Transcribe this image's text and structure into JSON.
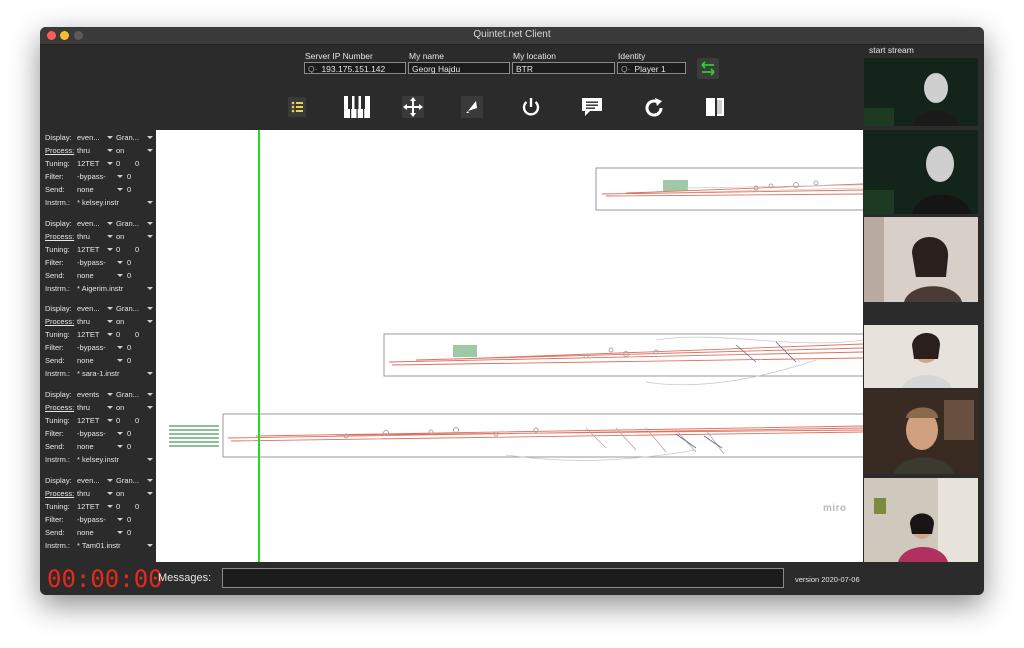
{
  "window": {
    "title": "Quintet.net Client"
  },
  "connection": {
    "server_ip": {
      "label": "Server IP Number",
      "value": "193.175.151.142"
    },
    "name": {
      "label": "My name",
      "value": "Georg Hajdu"
    },
    "location": {
      "label": "My location",
      "value": "BTR"
    },
    "identity": {
      "label": "Identity",
      "value": "Player 1"
    }
  },
  "toolbar": {
    "icons": [
      "list-icon",
      "piano-keys-icon",
      "move-icon",
      "rocket-icon",
      "power-icon",
      "chat-icon",
      "refresh-icon",
      "split-view-icon"
    ]
  },
  "channels": [
    {
      "display_label": "Display:",
      "display_value": "even...",
      "display_mode": "Gran...",
      "process_label": "Process:",
      "process_value": "thru",
      "process_state": "on",
      "tuning_label": "Tuning:",
      "tuning_value": "12TET",
      "tuning_a": "0",
      "tuning_b": "0",
      "filter_label": "Filter:",
      "filter_value": "-bypass-",
      "filter_num": "0",
      "send_label": "Send:",
      "send_value": "none",
      "send_num": "0",
      "instrm_label": "Instrm.:",
      "instrm_value": "* kelsey.instr"
    },
    {
      "display_label": "Display:",
      "display_value": "even...",
      "display_mode": "Gran...",
      "process_label": "Process:",
      "process_value": "thru",
      "process_state": "on",
      "tuning_label": "Tuning:",
      "tuning_value": "12TET",
      "tuning_a": "0",
      "tuning_b": "0",
      "filter_label": "Filter:",
      "filter_value": "-bypass-",
      "filter_num": "0",
      "send_label": "Send:",
      "send_value": "none",
      "send_num": "0",
      "instrm_label": "Instrm.:",
      "instrm_value": "* Aigerim.instr"
    },
    {
      "display_label": "Display:",
      "display_value": "even...",
      "display_mode": "Gran...",
      "process_label": "Process:",
      "process_value": "thru",
      "process_state": "on",
      "tuning_label": "Tuning:",
      "tuning_value": "12TET",
      "tuning_a": "0",
      "tuning_b": "0",
      "filter_label": "Filter:",
      "filter_value": "-bypass-",
      "filter_num": "0",
      "send_label": "Send:",
      "send_value": "none",
      "send_num": "0",
      "instrm_label": "Instrm.:",
      "instrm_value": "* sara-1.instr"
    },
    {
      "display_label": "Display:",
      "display_value": "events",
      "display_mode": "Gran...",
      "process_label": "Process:",
      "process_value": "thru",
      "process_state": "on",
      "tuning_label": "Tuning:",
      "tuning_value": "12TET",
      "tuning_a": "0",
      "tuning_b": "0",
      "filter_label": "Filter:",
      "filter_value": "-bypass-",
      "filter_num": "0",
      "send_label": "Send:",
      "send_value": "none",
      "send_num": "0",
      "instrm_label": "Instrm.:",
      "instrm_value": "* kelsey.instr"
    },
    {
      "display_label": "Display:",
      "display_value": "even...",
      "display_mode": "Gran...",
      "process_label": "Process:",
      "process_value": "thru",
      "process_state": "on",
      "tuning_label": "Tuning:",
      "tuning_value": "12TET",
      "tuning_a": "0",
      "tuning_b": "0",
      "filter_label": "Filter:",
      "filter_value": "-bypass-",
      "filter_num": "0",
      "send_label": "Send:",
      "send_value": "none",
      "send_num": "0",
      "instrm_label": "Instrm.:",
      "instrm_value": "* Tam01.instr"
    }
  ],
  "canvas": {
    "watermark": "miro"
  },
  "videos": {
    "label": "start stream"
  },
  "footer": {
    "timer": "00:00:00",
    "messages_label": "Messages:",
    "messages_value": "",
    "version": "version 2020-07-06"
  },
  "colors": {
    "accent_green": "#22dd22",
    "timer_red": "#e42a1d",
    "score_red": "#e0705e",
    "toolbar_yellow": "#e8d24a"
  }
}
